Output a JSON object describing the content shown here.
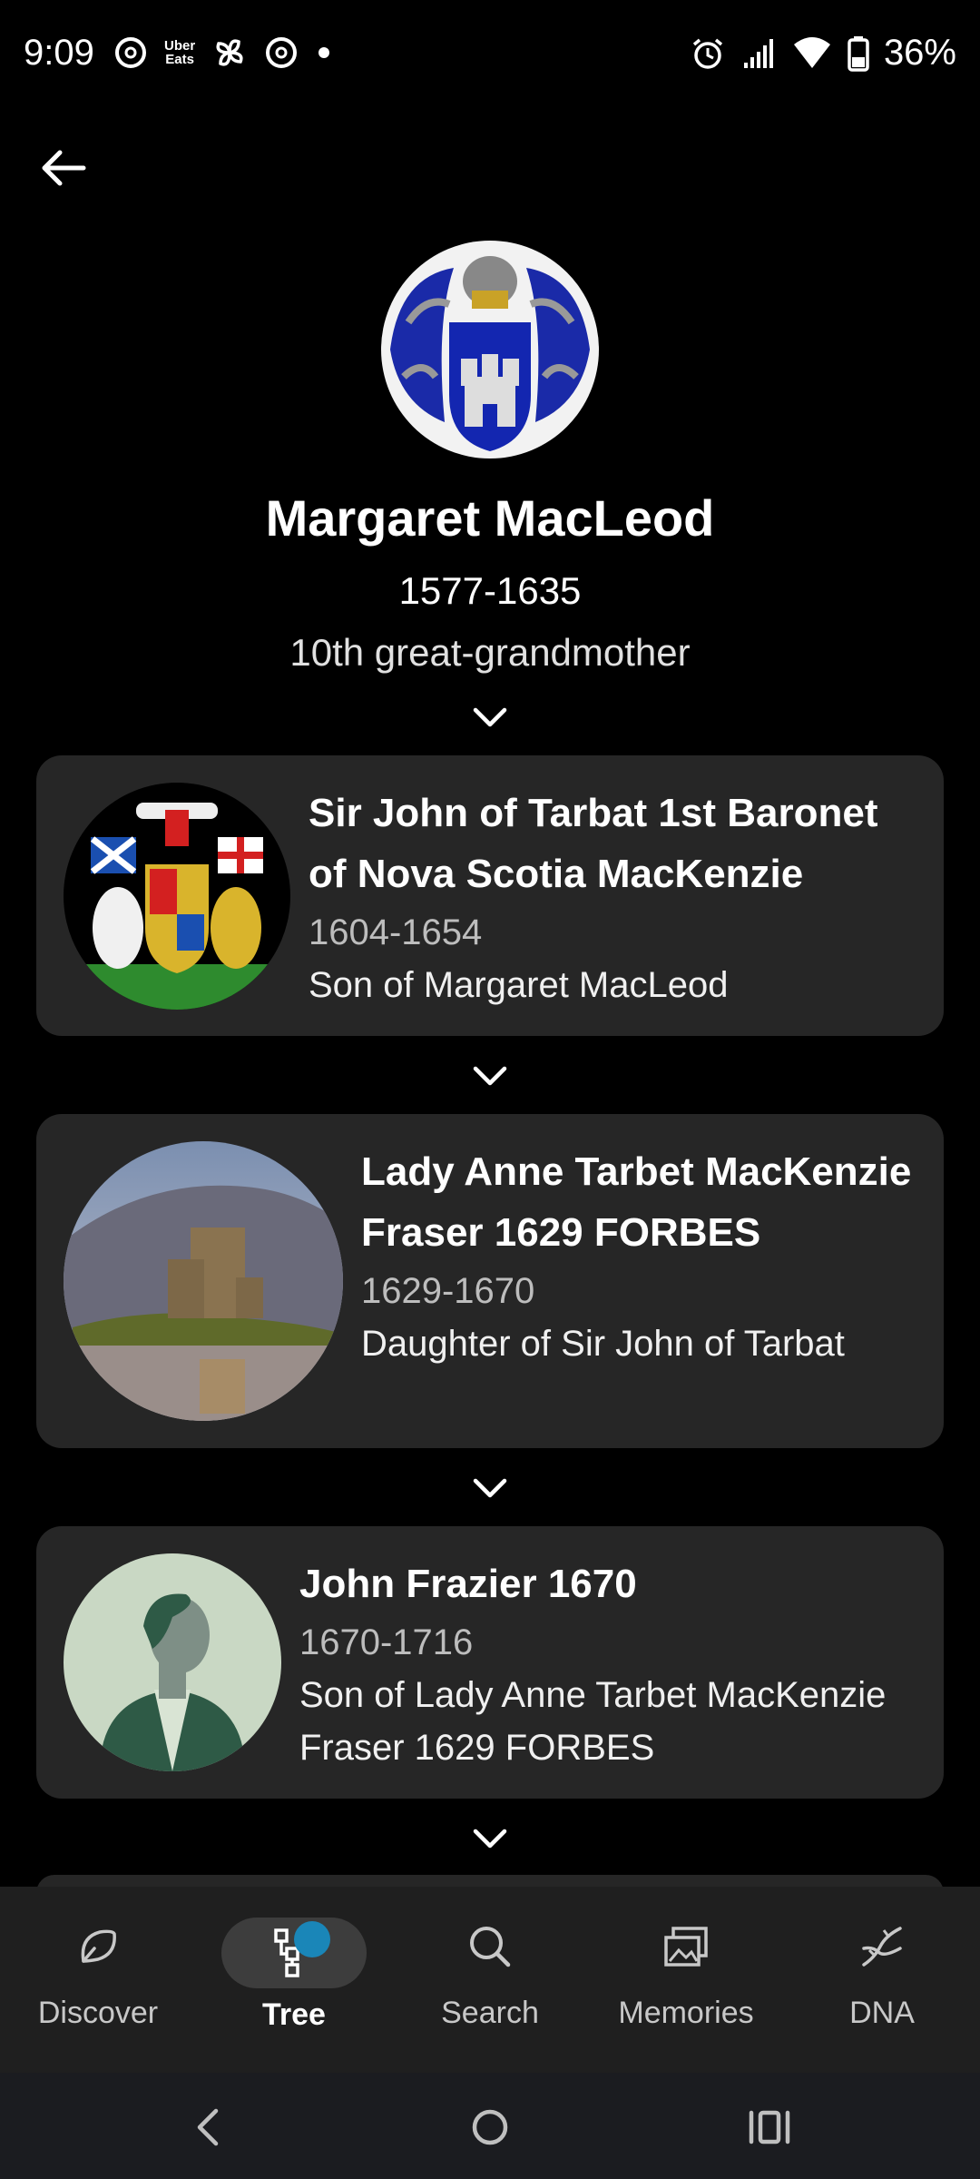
{
  "status_bar": {
    "time": "9:09",
    "uber_top": "Uber",
    "uber_bottom": "Eats",
    "battery": "36%"
  },
  "header": {
    "name": "Margaret MacLeod",
    "dates": "1577-1635",
    "relationship": "10th great-grandmother"
  },
  "cards": [
    {
      "name": "Sir John of Tarbat 1st Baronet of Nova Scotia MacKenzie",
      "dates": "1604-1654",
      "relationship": "Son of Margaret MacLeod"
    },
    {
      "name": "Lady Anne Tarbet MacKenzie Fraser 1629 FORBES",
      "dates": "1629-1670",
      "relationship": "Daughter of Sir John of Tarbat"
    },
    {
      "name": "John Frazier 1670",
      "dates": "1670-1716",
      "relationship": "Son of Lady Anne Tarbet MacKenzie Fraser 1629 FORBES"
    }
  ],
  "nav": {
    "discover": "Discover",
    "tree": "Tree",
    "search": "Search",
    "memories": "Memories",
    "dna": "DNA"
  },
  "colors": {
    "background": "#000000",
    "card": "#262626",
    "nav_bg": "#1f1f1f",
    "accent": "#1a86b8"
  }
}
